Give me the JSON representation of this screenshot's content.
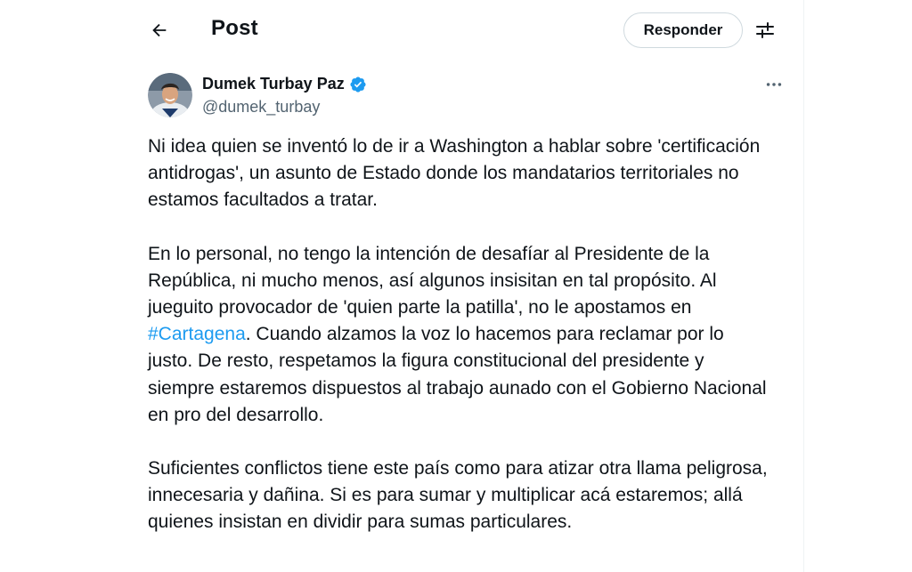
{
  "header": {
    "title": "Post",
    "reply_label": "Responder",
    "back_icon": "arrow-left-icon",
    "settings_icon": "sliders-icon"
  },
  "author": {
    "name": "Dumek Turbay Paz",
    "handle": "@dumek_turbay",
    "verified_icon": "verified-badge-icon",
    "verified_color": "#1d9bf0",
    "more_icon": "ellipsis-icon"
  },
  "post": {
    "paragraph1": "Ni idea quien se inventó lo de ir a Washington a hablar sobre 'certificación antidrogas', un asunto de Estado donde los mandatarios territoriales no estamos facultados a tratar.",
    "paragraph2_before": "En lo personal, no tengo la intención de desafíar al Presidente de la República, ni mucho menos, así algunos insisitan en tal propósito. Al jueguito provocador de 'quien parte la patilla', no le apostamos en ",
    "hashtag": "#Cartagena",
    "paragraph2_after": ". Cuando alzamos la voz lo hacemos para reclamar por lo justo. De resto, respetamos la figura constitucional del presidente y siempre estaremos dispuestos al trabajo aunado con el Gobierno Nacional en pro del desarrollo.",
    "paragraph3": "Suficientes conflictos tiene este país como para atizar otra llama peligrosa, innecesaria y dañina. Si es para sumar y multiplicar acá estaremos; allá quienes insistan en dividir para sumas particulares."
  },
  "colors": {
    "text": "#0f1419",
    "secondary": "#536471",
    "accent": "#1d9bf0",
    "border": "#cfd9de"
  }
}
